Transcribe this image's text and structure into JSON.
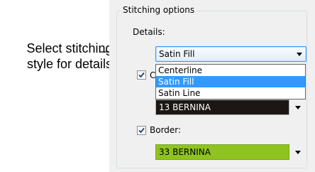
{
  "callout": {
    "line1": "Select stitching",
    "line2": "style for details"
  },
  "group": {
    "title": "Stitching options"
  },
  "details": {
    "label": "Details:",
    "selected": "Satin Fill",
    "options": [
      "Centerline",
      "Satin Fill",
      "Satin Line"
    ],
    "highlighted_index": 1
  },
  "color": {
    "label_partial": "C",
    "checked": true,
    "swatch_value": "13 BERNINA",
    "swatch_color": "#1c1714",
    "text_color": "#ffffff"
  },
  "border": {
    "label": "Border:",
    "checked": true,
    "swatch_value": "33 BERNINA",
    "swatch_color": "#8fc31f",
    "text_color": "#000000"
  },
  "colors": {
    "panel_bg": "#f0f0f0",
    "selection": "#3399ff",
    "combo_border": "#3399ff"
  }
}
